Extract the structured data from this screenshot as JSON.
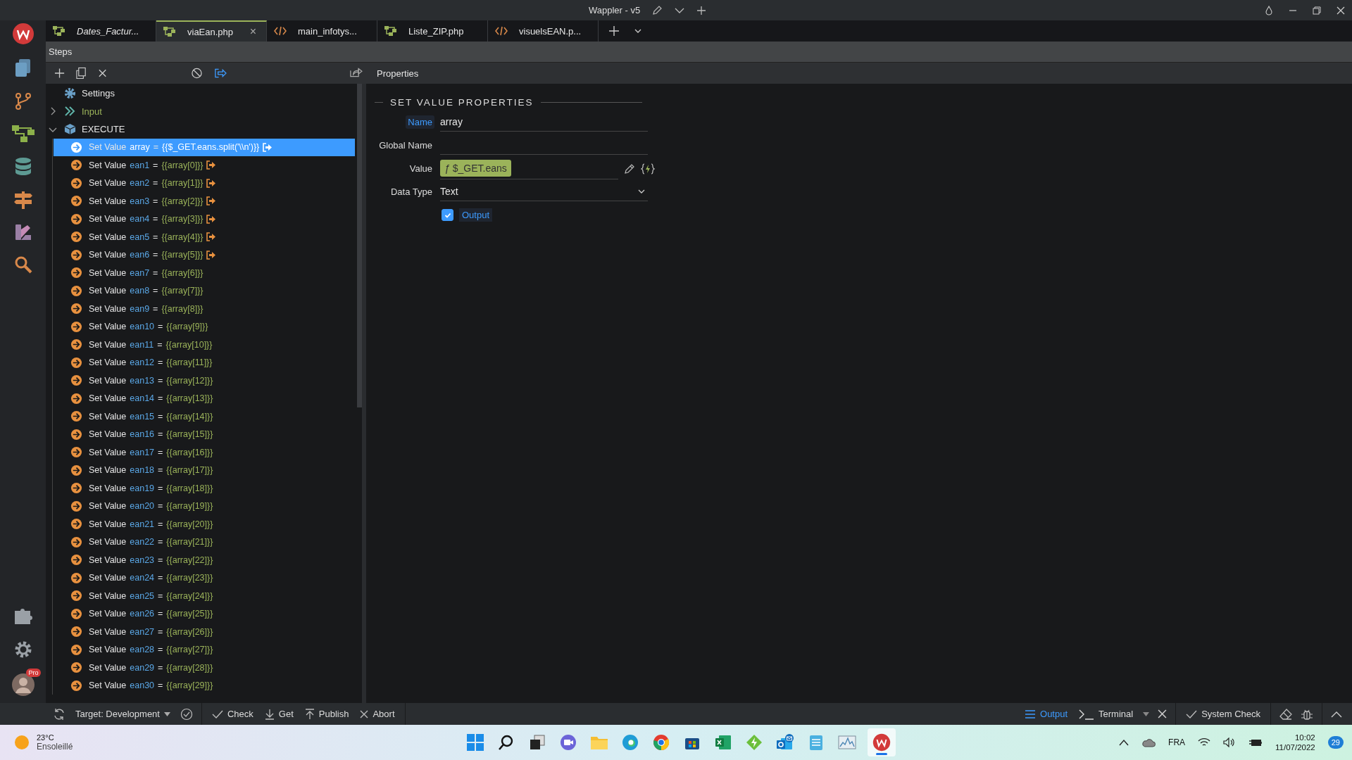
{
  "window": {
    "title": "Wappler - v5"
  },
  "tabs": [
    {
      "label": "Dates_Factur...",
      "kind": "flow",
      "selected": false,
      "italic": true
    },
    {
      "label": "viaEan.php",
      "kind": "flow",
      "selected": true,
      "italic": false,
      "close": "×"
    },
    {
      "label": "main_infotys...",
      "kind": "code",
      "selected": false,
      "italic": false
    },
    {
      "label": "Liste_ZIP.php",
      "kind": "flow",
      "selected": false,
      "italic": false
    },
    {
      "label": "visuelsEAN.p...",
      "kind": "code",
      "selected": false,
      "italic": false
    }
  ],
  "steps_panel": {
    "title": "Steps"
  },
  "properties_panel": {
    "title": "Properties",
    "section": "SET VALUE PROPERTIES",
    "fields": [
      {
        "kind": "text",
        "label": "Name",
        "focused": true,
        "value": "array"
      },
      {
        "kind": "text",
        "label": "Global Name",
        "focused": false
      },
      {
        "kind": "expression",
        "label": "Value",
        "focused": false,
        "prefix": "ƒ",
        "value": "$_GET.eans"
      },
      {
        "kind": "select",
        "label": "Data Type",
        "focused": false,
        "value": "Text"
      },
      {
        "kind": "checkbox",
        "label": "Output",
        "checked": true
      }
    ]
  },
  "tree": [
    {
      "kind": "settings",
      "label": "Settings"
    },
    {
      "kind": "input",
      "label": "Input",
      "expanded": false
    },
    {
      "kind": "execute",
      "label": "EXECUTE",
      "expanded": true,
      "children": [
        {
          "label": "Set Value",
          "name": "array",
          "equals": "=",
          "value": "{{$_GET.eans.split('\\\\n')}}",
          "output": true,
          "selected": true
        },
        {
          "label": "Set Value",
          "name": "ean1",
          "equals": "=",
          "value": "{{array[0]}}",
          "output": true,
          "selected": false
        },
        {
          "label": "Set Value",
          "name": "ean2",
          "equals": "=",
          "value": "{{array[1]}}",
          "output": true,
          "selected": false
        },
        {
          "label": "Set Value",
          "name": "ean3",
          "equals": "=",
          "value": "{{array[2]}}",
          "output": true,
          "selected": false
        },
        {
          "label": "Set Value",
          "name": "ean4",
          "equals": "=",
          "value": "{{array[3]}}",
          "output": true,
          "selected": false
        },
        {
          "label": "Set Value",
          "name": "ean5",
          "equals": "=",
          "value": "{{array[4]}}",
          "output": true,
          "selected": false
        },
        {
          "label": "Set Value",
          "name": "ean6",
          "equals": "=",
          "value": "{{array[5]}}",
          "output": true,
          "selected": false
        },
        {
          "label": "Set Value",
          "name": "ean7",
          "equals": "=",
          "value": "{{array[6]}}",
          "output": false,
          "selected": false
        },
        {
          "label": "Set Value",
          "name": "ean8",
          "equals": "=",
          "value": "{{array[7]}}",
          "output": false,
          "selected": false
        },
        {
          "label": "Set Value",
          "name": "ean9",
          "equals": "=",
          "value": "{{array[8]}}",
          "output": false,
          "selected": false
        },
        {
          "label": "Set Value",
          "name": "ean10",
          "equals": "=",
          "value": "{{array[9]}}",
          "output": false,
          "selected": false
        },
        {
          "label": "Set Value",
          "name": "ean11",
          "equals": "=",
          "value": "{{array[10]}}",
          "output": false,
          "selected": false
        },
        {
          "label": "Set Value",
          "name": "ean12",
          "equals": "=",
          "value": "{{array[11]}}",
          "output": false,
          "selected": false
        },
        {
          "label": "Set Value",
          "name": "ean13",
          "equals": "=",
          "value": "{{array[12]}}",
          "output": false,
          "selected": false
        },
        {
          "label": "Set Value",
          "name": "ean14",
          "equals": "=",
          "value": "{{array[13]}}",
          "output": false,
          "selected": false
        },
        {
          "label": "Set Value",
          "name": "ean15",
          "equals": "=",
          "value": "{{array[14]}}",
          "output": false,
          "selected": false
        },
        {
          "label": "Set Value",
          "name": "ean16",
          "equals": "=",
          "value": "{{array[15]}}",
          "output": false,
          "selected": false
        },
        {
          "label": "Set Value",
          "name": "ean17",
          "equals": "=",
          "value": "{{array[16]}}",
          "output": false,
          "selected": false
        },
        {
          "label": "Set Value",
          "name": "ean18",
          "equals": "=",
          "value": "{{array[17]}}",
          "output": false,
          "selected": false
        },
        {
          "label": "Set Value",
          "name": "ean19",
          "equals": "=",
          "value": "{{array[18]}}",
          "output": false,
          "selected": false
        },
        {
          "label": "Set Value",
          "name": "ean20",
          "equals": "=",
          "value": "{{array[19]}}",
          "output": false,
          "selected": false
        },
        {
          "label": "Set Value",
          "name": "ean21",
          "equals": "=",
          "value": "{{array[20]}}",
          "output": false,
          "selected": false
        },
        {
          "label": "Set Value",
          "name": "ean22",
          "equals": "=",
          "value": "{{array[21]}}",
          "output": false,
          "selected": false
        },
        {
          "label": "Set Value",
          "name": "ean23",
          "equals": "=",
          "value": "{{array[22]}}",
          "output": false,
          "selected": false
        },
        {
          "label": "Set Value",
          "name": "ean24",
          "equals": "=",
          "value": "{{array[23]}}",
          "output": false,
          "selected": false
        },
        {
          "label": "Set Value",
          "name": "ean25",
          "equals": "=",
          "value": "{{array[24]}}",
          "output": false,
          "selected": false
        },
        {
          "label": "Set Value",
          "name": "ean26",
          "equals": "=",
          "value": "{{array[25]}}",
          "output": false,
          "selected": false
        },
        {
          "label": "Set Value",
          "name": "ean27",
          "equals": "=",
          "value": "{{array[26]}}",
          "output": false,
          "selected": false
        },
        {
          "label": "Set Value",
          "name": "ean28",
          "equals": "=",
          "value": "{{array[27]}}",
          "output": false,
          "selected": false
        },
        {
          "label": "Set Value",
          "name": "ean29",
          "equals": "=",
          "value": "{{array[28]}}",
          "output": false,
          "selected": false
        },
        {
          "label": "Set Value",
          "name": "ean30",
          "equals": "=",
          "value": "{{array[29]}}",
          "output": false,
          "selected": false
        }
      ]
    }
  ],
  "user": {
    "badge": "Pro"
  },
  "status_bar": {
    "target_label": "Target:",
    "target": "Development",
    "actions": [
      {
        "kind": "check",
        "label": "Check"
      },
      {
        "kind": "get",
        "label": "Get"
      },
      {
        "kind": "publish",
        "label": "Publish"
      },
      {
        "kind": "abort",
        "label": "Abort"
      }
    ],
    "panels": [
      {
        "kind": "output",
        "label": "Output",
        "selected": true
      },
      {
        "kind": "terminal",
        "label": "Terminal",
        "selected": false
      }
    ],
    "system_check": "System Check"
  },
  "taskbar": {
    "temperature": "23°C",
    "weather": "Ensoleillé",
    "apps": [
      {
        "kind": "start",
        "active": false
      },
      {
        "kind": "search",
        "active": false
      },
      {
        "kind": "taskview",
        "active": false
      },
      {
        "kind": "chat",
        "active": false
      },
      {
        "kind": "folder",
        "active": false
      },
      {
        "kind": "edge",
        "active": false
      },
      {
        "kind": "chrome",
        "active": false
      },
      {
        "kind": "store",
        "active": false
      },
      {
        "kind": "excel",
        "active": false
      },
      {
        "kind": "bolt",
        "active": false
      },
      {
        "kind": "outlook",
        "active": false
      },
      {
        "kind": "notepad",
        "active": false
      },
      {
        "kind": "monitor",
        "active": false
      },
      {
        "kind": "wappler",
        "active": true
      }
    ],
    "language": "FRA",
    "time": "10:02",
    "date": "11/07/2022",
    "notifications": "29"
  }
}
